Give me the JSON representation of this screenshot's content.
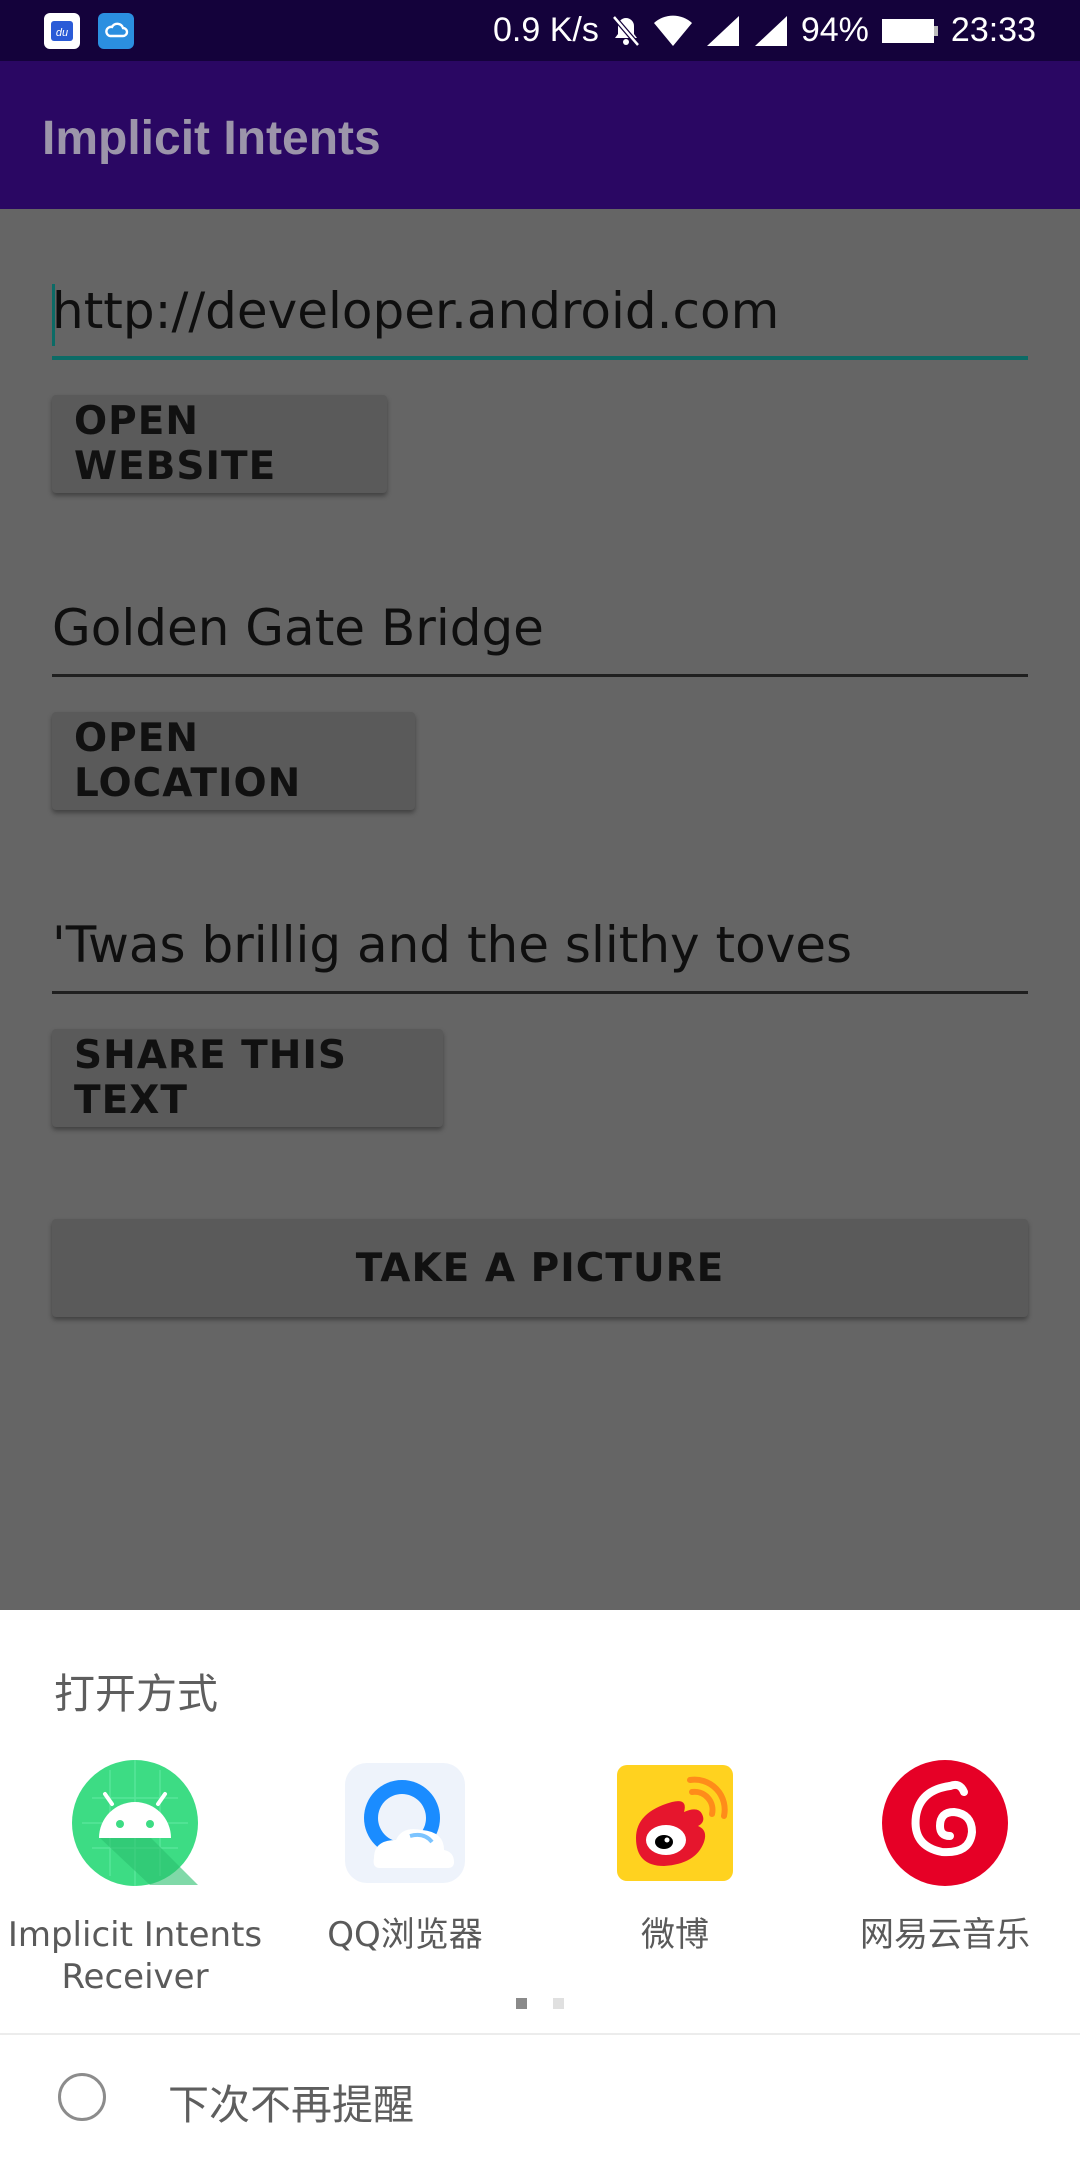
{
  "status_bar": {
    "speed": "0.9 K/s",
    "battery": "94%",
    "time": "23:33",
    "icons": [
      "notification-app-icon",
      "cloud-app-icon",
      "mute-bell-icon",
      "wifi-icon",
      "signal-icon",
      "battery-icon"
    ]
  },
  "app_bar": {
    "title": "Implicit Intents"
  },
  "main": {
    "website_field": {
      "value": "http://developer.android.com"
    },
    "open_website_button": "OPEN WEBSITE",
    "location_field": {
      "value": "Golden Gate Bridge"
    },
    "open_location_button": "OPEN LOCATION",
    "share_field": {
      "value": "'Twas brillig and the slithy toves"
    },
    "share_button": "SHARE THIS TEXT",
    "picture_button": "TAKE A PICTURE"
  },
  "chooser": {
    "title": "打开方式",
    "apps": [
      {
        "label": "Implicit Intents\nReceiver",
        "icon": "android-icon",
        "color": "#3ddc84"
      },
      {
        "label": "QQ浏览器",
        "icon": "qq-browser-icon",
        "color": "#1a8cff"
      },
      {
        "label": "微博",
        "icon": "weibo-icon",
        "color": "#f5c518"
      },
      {
        "label": "网易云音乐",
        "icon": "netease-music-icon",
        "color": "#e60026"
      }
    ],
    "remember_label": "下次不再提醒"
  }
}
